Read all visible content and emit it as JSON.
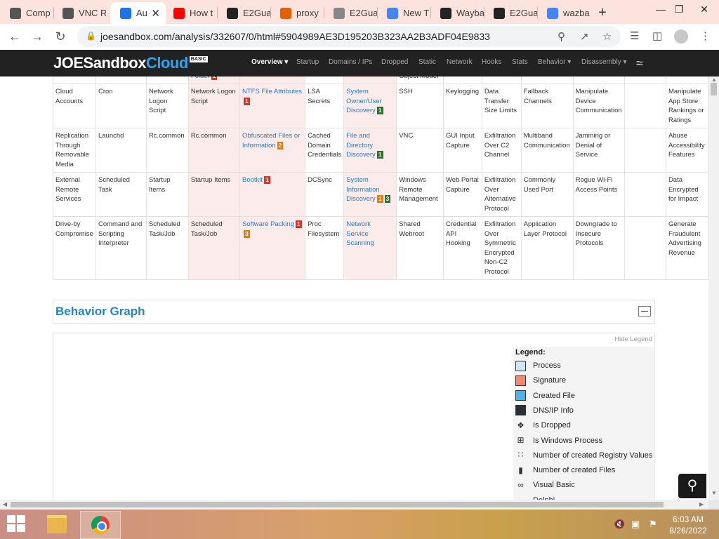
{
  "browser": {
    "tabs": [
      {
        "title": "Comp",
        "icon": "joesandbox-icon",
        "color": "#555555"
      },
      {
        "title": "VNC R",
        "icon": "joesandbox-icon",
        "color": "#555555"
      },
      {
        "title": "Au",
        "icon": "joesandbox-icon",
        "color": "#1a73e8",
        "active": true
      },
      {
        "title": "How t",
        "icon": "youtube-icon",
        "color": "#ff0000"
      },
      {
        "title": "E2Gua",
        "icon": "github-icon",
        "color": "#222222"
      },
      {
        "title": "proxy",
        "icon": "firefox-icon",
        "color": "#e66000"
      },
      {
        "title": "E2Gua",
        "icon": "globe-icon",
        "color": "#888888"
      },
      {
        "title": "New T",
        "icon": "chrome-icon",
        "color": "#4285f4"
      },
      {
        "title": "Wayba",
        "icon": "wayback-icon",
        "color": "#222222"
      },
      {
        "title": "E2Gua",
        "icon": "github-icon",
        "color": "#222222"
      },
      {
        "title": "wazba",
        "icon": "google-icon",
        "color": "#4285f4"
      }
    ],
    "url": "joesandbox.com/analysis/332607/0/html#5904989AE3D195203B323AA2B3ADF04E9833"
  },
  "site": {
    "logo_joe": "JOE",
    "logo_sandbox": "Sandbox",
    "logo_cloud": "Cloud",
    "logo_badge": "BASIC",
    "nav": [
      {
        "label": "Overview ▾",
        "active": true
      },
      {
        "label": "Startup"
      },
      {
        "label": "Domains / IPs"
      },
      {
        "label": "Dropped"
      },
      {
        "label": "Static"
      },
      {
        "label": "Network"
      },
      {
        "label": "Hooks"
      },
      {
        "label": "Stats"
      },
      {
        "label": "Behavior ▾"
      },
      {
        "label": "Disassembly ▾"
      }
    ]
  },
  "matrix": {
    "partial_row": [
      "",
      "",
      "",
      "Folder",
      "",
      "",
      "",
      "Object Model",
      "",
      "",
      "",
      "",
      "",
      ""
    ],
    "partial_badges": {
      "3": [
        [
          "1",
          "red"
        ]
      ]
    },
    "rows": [
      {
        "cells": [
          "Cloud Accounts",
          "Cron",
          "Network Logon Script",
          "Network Logon Script",
          "NTFS File Attributes",
          "LSA Secrets",
          "System Owner/User Discovery",
          "SSH",
          "Keylogging",
          "Data Transfer Size Limits",
          "Fallback Channels",
          "Manipulate Device Communication",
          "",
          "Manipulate App Store Rankings or Ratings"
        ],
        "badges": {
          "4": [
            [
              "1",
              "red"
            ]
          ],
          "6": [
            [
              "1",
              "green"
            ]
          ]
        }
      },
      {
        "cells": [
          "Replication Through Removable Media",
          "Launchd",
          "Rc.common",
          "Rc.common",
          "Obfuscated Files or Information",
          "Cached Domain Credentials",
          "File and Directory Discovery",
          "VNC",
          "GUI Input Capture",
          "Exfiltration Over C2 Channel",
          "Multiband Communication",
          "Jamming or Denial of Service",
          "",
          "Abuse Accessibility Features"
        ],
        "badges": {
          "4": [
            [
              "2",
              "orange"
            ]
          ],
          "6": [
            [
              "1",
              "green"
            ]
          ]
        }
      },
      {
        "cells": [
          "External Remote Services",
          "Scheduled Task",
          "Startup Items",
          "Startup Items",
          "Bootkit",
          "DCSync",
          "System Information Discovery",
          "Windows Remote Management",
          "Web Portal Capture",
          "Exfiltration Over Alternative Protocol",
          "Commonly Used Port",
          "Rogue Wi-Fi Access Points",
          "",
          "Data Encrypted for Impact"
        ],
        "badges": {
          "4": [
            [
              "1",
              "red"
            ]
          ],
          "6": [
            [
              "1",
              "orange"
            ],
            [
              "3",
              "green"
            ]
          ]
        }
      },
      {
        "cells": [
          "Drive-by Compromise",
          "Command and Scripting Interpreter",
          "Scheduled Task/Job",
          "Scheduled Task/Job",
          "Software Packing",
          "Proc Filesystem",
          "Network Service Scanning",
          "Shared Webroot",
          "Credential API Hooking",
          "Exfiltration Over Symmetric Encrypted Non-C2 Protocol",
          "Application Layer Protocol",
          "Downgrade to Insecure Protocols",
          "",
          "Generate Fraudulent Advertising Revenue"
        ],
        "badges": {
          "4": [
            [
              "1",
              "red"
            ],
            [
              "3",
              "orange"
            ]
          ]
        }
      }
    ],
    "link_columns": [
      4,
      6
    ]
  },
  "behavior": {
    "title": "Behavior Graph",
    "hide_legend": "Hide Legend",
    "legend_title": "Legend:",
    "legend": [
      {
        "label": "Process",
        "type": "swatch",
        "color": "#cde9f9"
      },
      {
        "label": "Signature",
        "type": "swatch",
        "color": "#f08a73"
      },
      {
        "label": "Created File",
        "type": "swatch",
        "color": "#48b3f0"
      },
      {
        "label": "DNS/IP Info",
        "type": "swatch",
        "color": "#2b2f33"
      },
      {
        "label": "Is Dropped",
        "type": "icon",
        "icon": "dropped-icon"
      },
      {
        "label": "Is Windows Process",
        "type": "icon",
        "icon": "windows-icon"
      },
      {
        "label": "Number of created Registry Values",
        "type": "icon",
        "icon": "registry-icon"
      },
      {
        "label": "Number of created Files",
        "type": "icon",
        "icon": "file-icon"
      },
      {
        "label": "Visual Basic",
        "type": "icon",
        "icon": "visual-basic-icon"
      },
      {
        "label": "Delphi",
        "type": "icon",
        "icon": "delphi-icon"
      }
    ]
  },
  "taskbar": {
    "time": "6:03 AM",
    "date": "8/26/2022"
  },
  "colors": {
    "badge_red": "#d9342b",
    "badge_orange": "#e07b1a",
    "badge_green": "#2f6e2f",
    "link": "#2b7bb9",
    "heading": "#2484c6"
  }
}
